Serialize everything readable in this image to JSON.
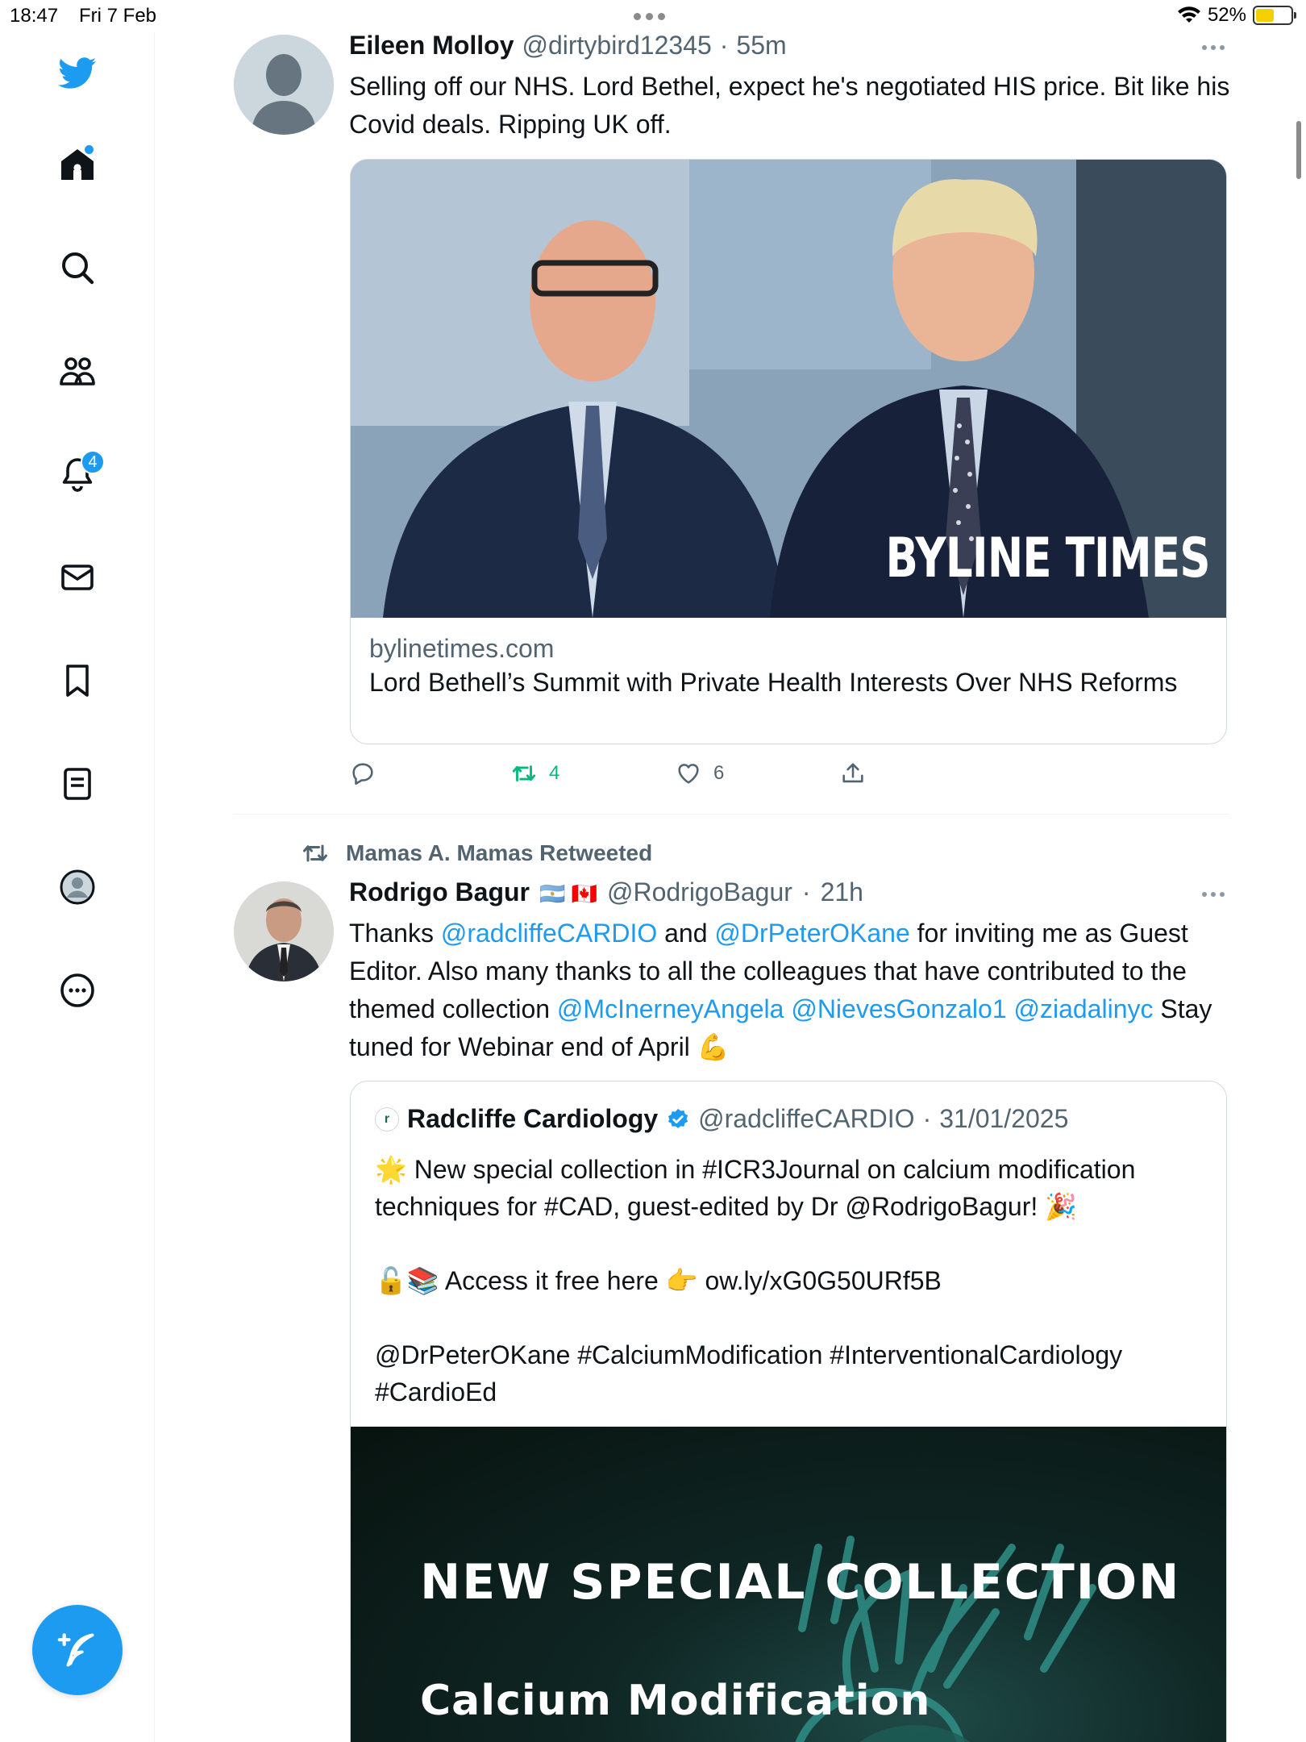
{
  "status_bar": {
    "time": "18:47",
    "date": "Fri 7 Feb",
    "battery": "52%",
    "battery_level": 0.52
  },
  "sidebar": {
    "icons": [
      "twitter-bird-icon",
      "home-icon",
      "search-icon",
      "communities-icon",
      "notifications-icon",
      "messages-icon",
      "bookmarks-icon",
      "lists-icon",
      "profile-icon",
      "more-icon"
    ],
    "notifications_badge": "4",
    "compose_icon": "compose-tweet-icon"
  },
  "colors": {
    "accent": "#1d9bf0",
    "retweet_green": "#00ba7c",
    "muted": "#536471"
  },
  "tweets": [
    {
      "author_name": "Eileen Molloy",
      "handle": "@dirtybird12345",
      "time": "55m",
      "text": "Selling off our NHS. Lord Bethel, expect he's negotiated HIS price. Bit like his Covid deals. Ripping UK off.",
      "card": {
        "domain": "bylinetimes.com",
        "title": "Lord Bethell’s Summit with Private Health Interests Over NHS Reforms",
        "image_watermark": "BYLINE TIMES"
      },
      "retweets": "4",
      "likes": "6"
    },
    {
      "retweeted_by": "Mamas A. Mamas Retweeted",
      "author_name": "Rodrigo Bagur",
      "flags": "🇦🇷 🇨🇦",
      "handle": "@RodrigoBagur",
      "time": "21h",
      "text_parts": {
        "p1": "Thanks ",
        "m1": "@radcliffeCARDIO",
        "p2": " and ",
        "m2": "@DrPeterOKane",
        "p3": " for inviting me as Guest Editor. Also many thanks to all the colleagues that have contributed to the themed collection ",
        "m3": "@McInerneyAngela",
        "p4": " ",
        "m4": "@NievesGonzalo1",
        "p5": " ",
        "m5": "@ziadalinyc",
        "p6": " Stay tuned for Webinar end of April 💪"
      },
      "quote": {
        "author_name": "Radcliffe Cardiology",
        "handle": "@radcliffeCARDIO",
        "date": "31/01/2025",
        "text": "🌟 New special collection in #ICR3Journal on calcium modification techniques for #CAD, guest-edited by Dr @RodrigoBagur! 🎉\n\n🔓📚 Access it free here 👉 ow.ly/xG0G50URf5B\n\n@DrPeterOKane #CalciumModification #InterventionalCardiology #CardioEd",
        "image_title": "NEW SPECIAL COLLECTION",
        "image_subtitle": "Calcium Modification"
      }
    }
  ]
}
